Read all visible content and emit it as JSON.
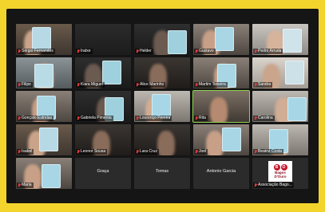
{
  "meeting": {
    "participants": [
      {
        "name": "Sérgio Fernandes",
        "muted": true,
        "scene": "shelf"
      },
      {
        "name": "Iratxe",
        "muted": true,
        "scene": "dark"
      },
      {
        "name": "Helder",
        "muted": true,
        "scene": "dark-book"
      },
      {
        "name": "Gustavo",
        "muted": true,
        "scene": "room-book"
      },
      {
        "name": "Pedro Arruda",
        "muted": true,
        "scene": "light"
      },
      {
        "name": "Filipe",
        "muted": true,
        "scene": "room"
      },
      {
        "name": "Kiara Miguel",
        "muted": true,
        "scene": "dark-book"
      },
      {
        "name": "Alice Marinho",
        "muted": true,
        "scene": "dark-person"
      },
      {
        "name": "Martim Teixeira",
        "muted": true,
        "scene": "room-book"
      },
      {
        "name": "Sandra",
        "muted": true,
        "scene": "light-person"
      },
      {
        "name": "Gonçalo Estrelas",
        "muted": true,
        "scene": "room-book"
      },
      {
        "name": "Gabriela Pimenta",
        "muted": true,
        "scene": "dark-book"
      },
      {
        "name": "Lourenço Pereira",
        "muted": true,
        "scene": "light-book"
      },
      {
        "name": "Rita",
        "muted": true,
        "scene": "room-person",
        "speaking": true
      },
      {
        "name": "Carolina",
        "muted": true,
        "scene": "light-book"
      },
      {
        "name": "Isabel",
        "muted": true,
        "scene": "shelf"
      },
      {
        "name": "Leonor Sousa",
        "muted": true,
        "scene": "dark-person"
      },
      {
        "name": "Lara Cruz",
        "muted": true,
        "scene": "dark-person"
      },
      {
        "name": "Joel",
        "muted": true,
        "scene": "room-book"
      },
      {
        "name": "Beatriz Costa",
        "muted": true,
        "scene": "light-book"
      },
      {
        "name": "Maria",
        "muted": true,
        "scene": "room-book"
      },
      {
        "name": "Graça",
        "muted": false,
        "scene": "name-only"
      },
      {
        "name": "Tomas",
        "muted": false,
        "scene": "name-only"
      },
      {
        "name": "Antonio Garcia",
        "muted": false,
        "scene": "name-only"
      },
      {
        "name": "Associação Bago...",
        "muted": true,
        "scene": "logo"
      }
    ],
    "logo": {
      "mark": "B O",
      "line1": "Bagos",
      "line2": "D'Ouro"
    }
  },
  "colors": {
    "background_frame": "#f3d42c",
    "window": "#151515",
    "mic_muted": "#e23b3b"
  }
}
